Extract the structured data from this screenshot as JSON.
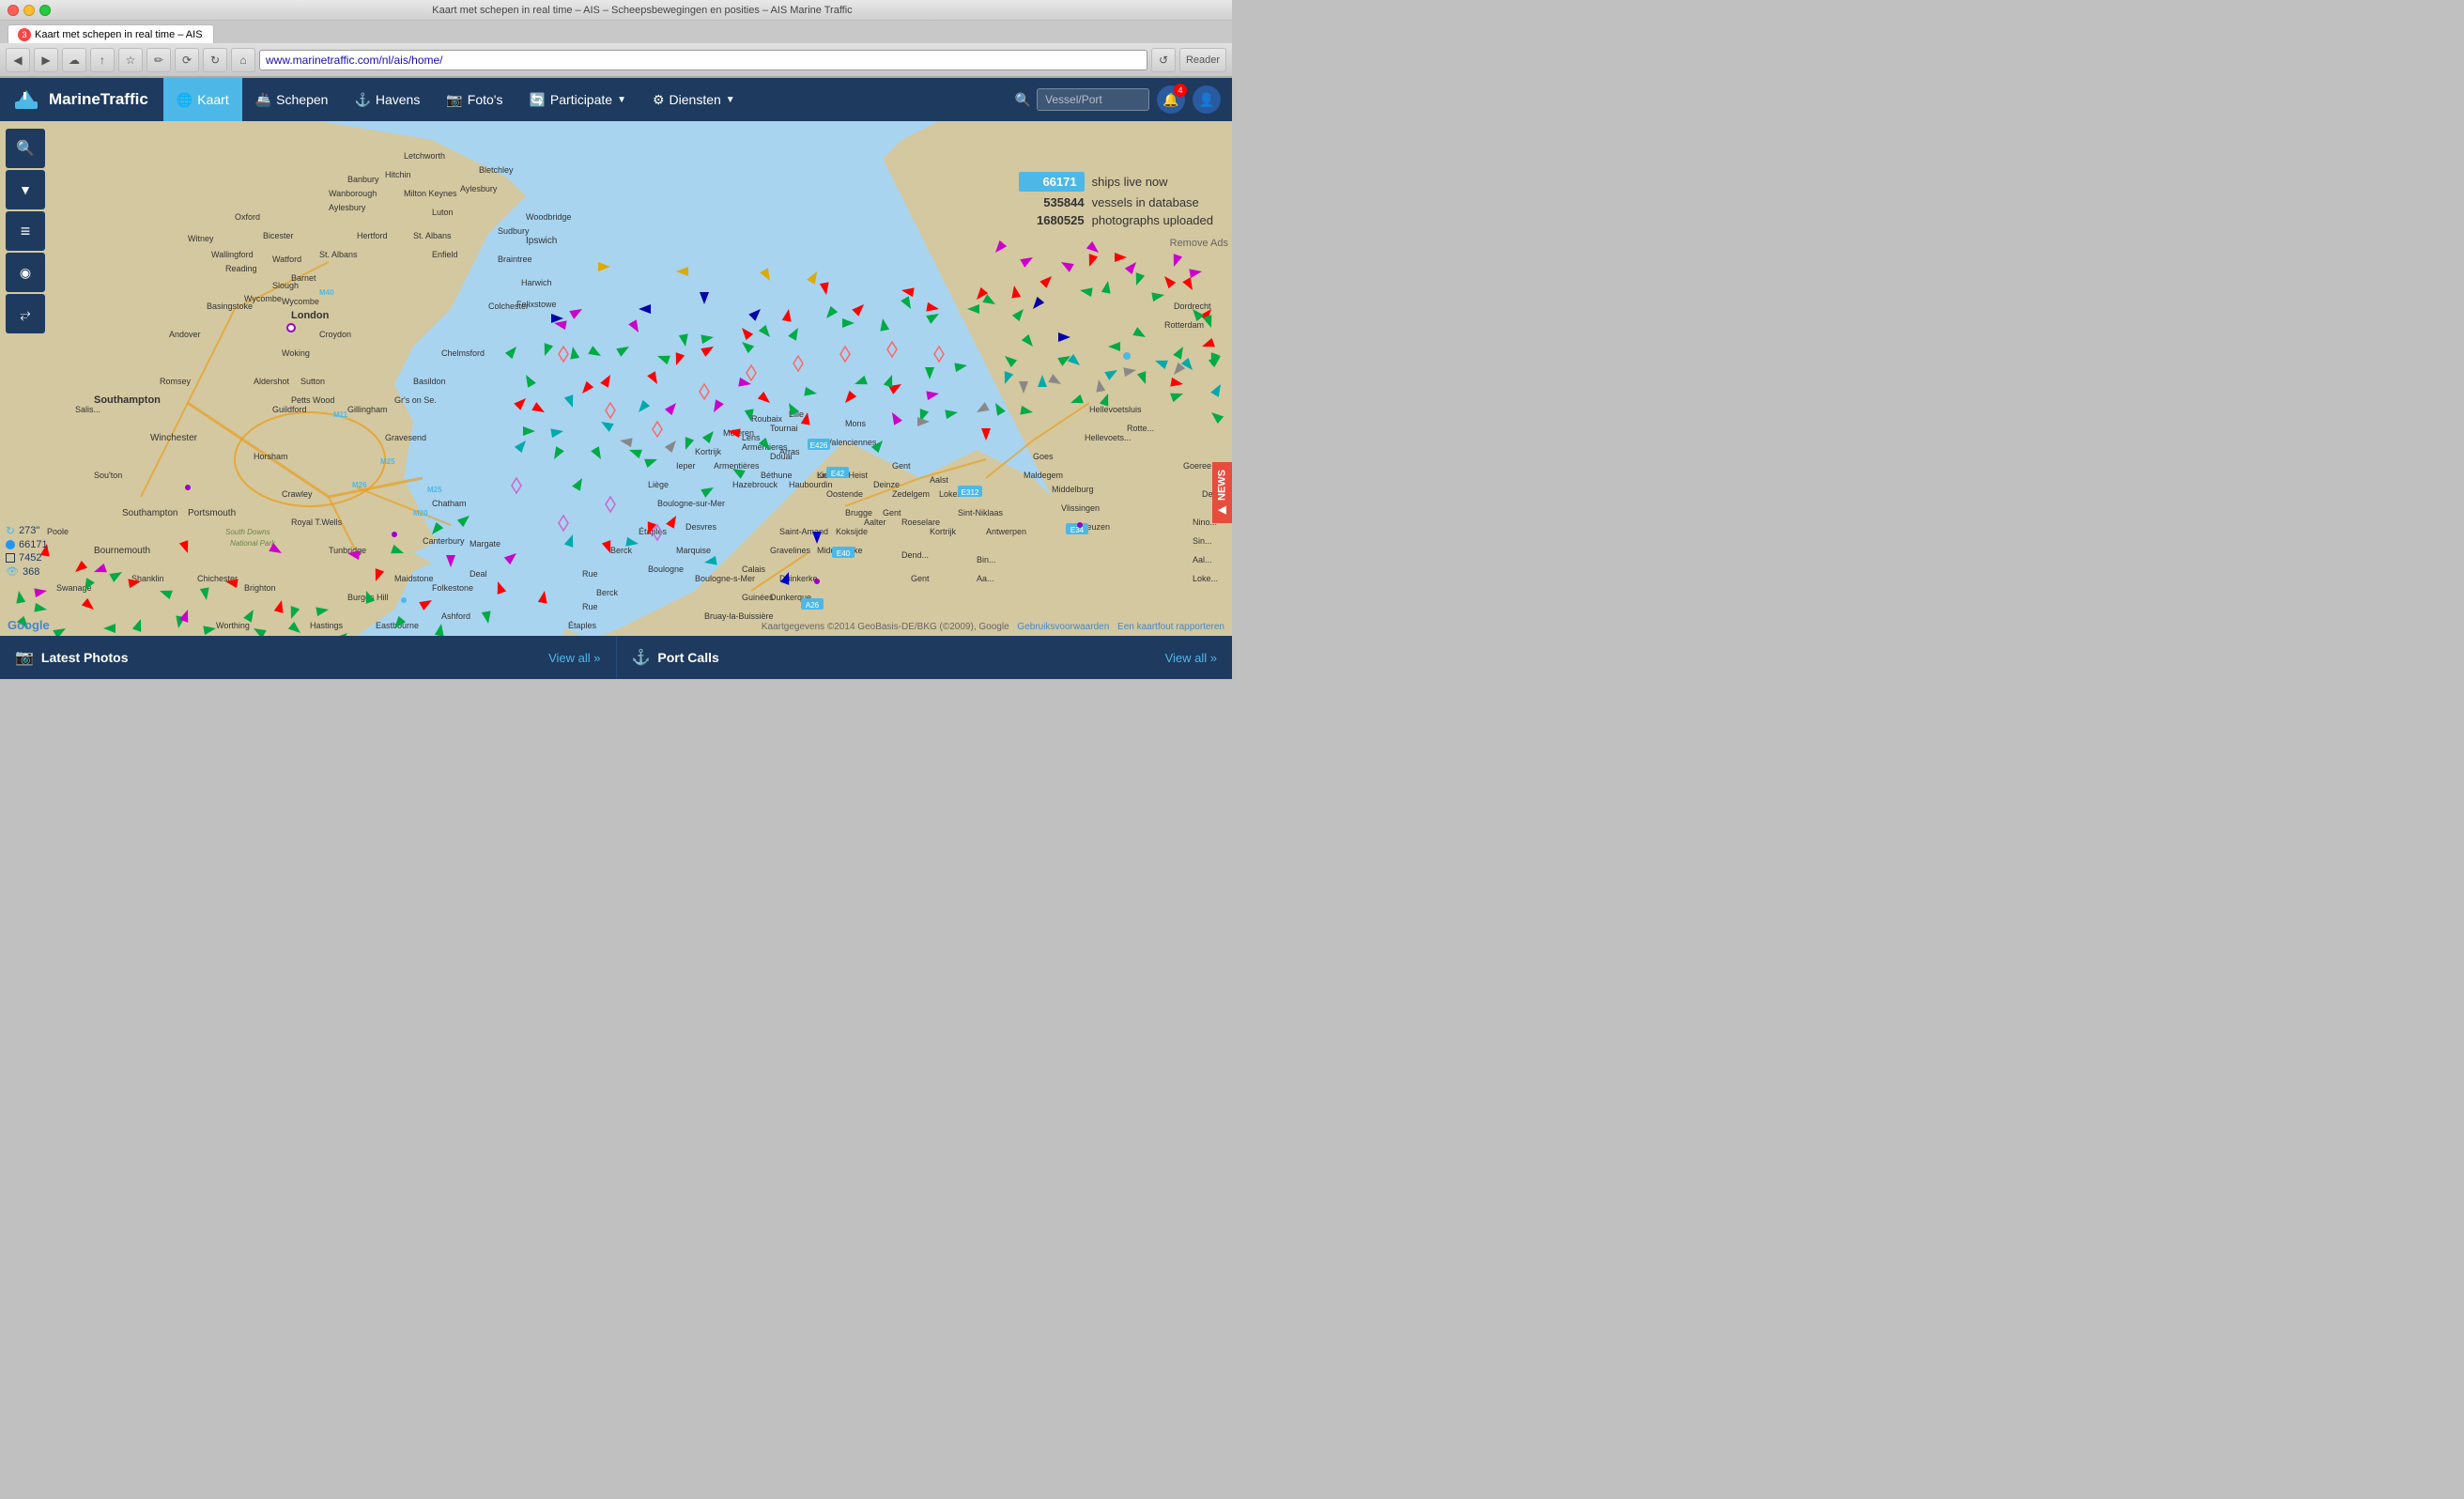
{
  "browser": {
    "title": "Kaart met schepen in real time – AIS – Scheepsbewegingen en posities – AIS Marine Traffic",
    "url": "www.marinetraffic.com/nl/ais/home/",
    "tab_notification": "3"
  },
  "nav": {
    "logo": "MarineTraffic",
    "items": [
      {
        "label": "Kaart",
        "icon": "🌐",
        "active": true
      },
      {
        "label": "Schepen",
        "icon": "🚢"
      },
      {
        "label": "Havens",
        "icon": "⚓"
      },
      {
        "label": "Foto's",
        "icon": "📷"
      },
      {
        "label": "Participate",
        "icon": "🔄"
      },
      {
        "label": "Diensten",
        "icon": "⚙"
      }
    ],
    "search_placeholder": "Vessel/Port",
    "bell_badge": "4"
  },
  "stats": {
    "live_ships_count": "66171",
    "live_ships_label": "ships live now",
    "vessels_count": "535844",
    "vessels_label": "vessels in database",
    "photos_count": "1680525",
    "photos_label": "photographs uploaded"
  },
  "map": {
    "zoom_level": "273\"",
    "mini_stats": [
      {
        "value": "273\"",
        "color": "#4db8e8",
        "icon": "↻"
      },
      {
        "value": "66171",
        "color": "#2196F3",
        "icon": "●"
      },
      {
        "value": "7452",
        "color": "#ffffff",
        "icon": "□"
      },
      {
        "value": "368",
        "color": "#4db8e8",
        "icon": "👁"
      }
    ],
    "attribution": "Kaartgegevens ©2014 GeoBasis-DE/BKG (©2009), Google",
    "attribution2": "Gebruiksvoorwaarden",
    "attribution3": "Een kaartfout rapporteren"
  },
  "bottom_bar": {
    "latest_photos_icon": "📷",
    "latest_photos_label": "Latest Photos",
    "latest_photos_link": "View all »",
    "port_calls_icon": "⚓",
    "port_calls_label": "Port Calls",
    "port_calls_link": "View all »"
  },
  "map_toolbar": {
    "search_icon": "🔍",
    "filter_icon": "▼",
    "layers_icon": "≡",
    "network_icon": "◉",
    "fullscreen_icon": "⤢"
  },
  "ads": {
    "remove_ads": "Remove Ads"
  }
}
